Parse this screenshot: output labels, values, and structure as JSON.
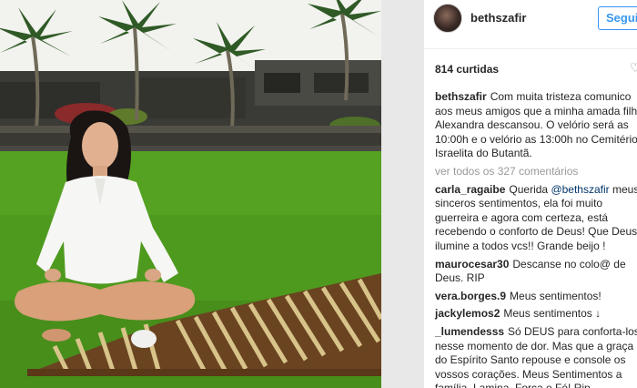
{
  "post": {
    "username": "bethszafir",
    "follow_label": "Seguir",
    "likes": "814 curtidas",
    "caption": {
      "author": "bethszafir",
      "text": "Com muita tristeza comunico aos meus amigos que a minha amada filha Alexandra descansou. O velório será as 10:00h e o velório as 13:00h no Cemitério Israelita do Butantã."
    },
    "view_all_comments": "ver todos os 327 comentários",
    "comments": [
      {
        "author": "carla_ragaibe",
        "mention": "@bethszafir",
        "pre": "Querida",
        "text": "meus sinceros sentimentos, ela foi muito guerreira e agora com certeza, está recebendo o conforto de Deus! Que Deus ilumine a todos vcs!! Grande beijo !"
      },
      {
        "author": "maurocesar30",
        "text": "Descanse no colo@ de Deus. RIP"
      },
      {
        "author": "vera.borges.9",
        "text": "Meus sentimentos!"
      },
      {
        "author": "jackylemos2",
        "text": "Meus sentimentos ↓"
      },
      {
        "author": "_lumendesss",
        "text": "Só DEUS para conforta-los nesse momento de dor. Mas que a graça do Espírito Santo repouse e console os vossos corações. Meus Sentimentos a família. Lamina, Força e Fé! Rip"
      }
    ]
  },
  "colors": {
    "accent": "#3897f0",
    "muted": "#999999",
    "mention": "#003569"
  },
  "icons": {
    "heart": "heart-icon"
  }
}
